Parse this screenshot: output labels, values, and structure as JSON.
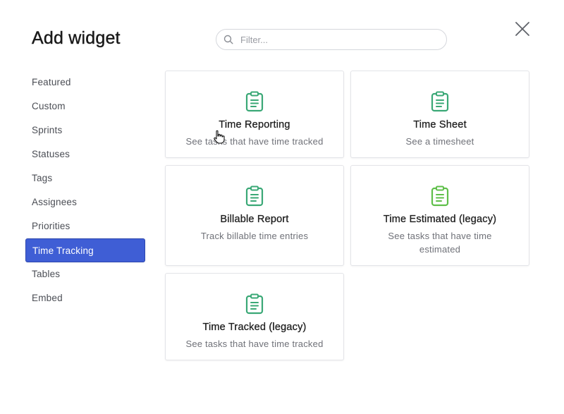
{
  "modal": {
    "title": "Add widget",
    "search": {
      "placeholder": "Filter...",
      "value": ""
    }
  },
  "sidebar": {
    "items": [
      {
        "label": "Featured"
      },
      {
        "label": "Custom"
      },
      {
        "label": "Sprints"
      },
      {
        "label": "Statuses"
      },
      {
        "label": "Tags"
      },
      {
        "label": "Assignees"
      },
      {
        "label": "Priorities"
      },
      {
        "label": "Time Tracking",
        "active": true
      },
      {
        "label": "Tables"
      },
      {
        "label": "Embed"
      }
    ]
  },
  "widgets": [
    {
      "icon": "clipboard-icon",
      "title": "Time Reporting",
      "description": "See tasks that have time tracked"
    },
    {
      "icon": "clipboard-icon",
      "title": "Time Sheet",
      "description": "See a timesheet"
    },
    {
      "icon": "clipboard-icon",
      "title": "Billable Report",
      "description": "Track billable time entries"
    },
    {
      "icon": "clipboard-icon",
      "title": "Time Estimated (legacy)",
      "description": "See tasks that have time estimated"
    },
    {
      "icon": "clipboard-icon",
      "title": "Time Tracked (legacy)",
      "description": "See tasks that have time tracked"
    }
  ],
  "colors": {
    "accent": "#3f5ed5",
    "icon_green": "#3aa876",
    "icon_green_light": "#5fbf4a"
  }
}
